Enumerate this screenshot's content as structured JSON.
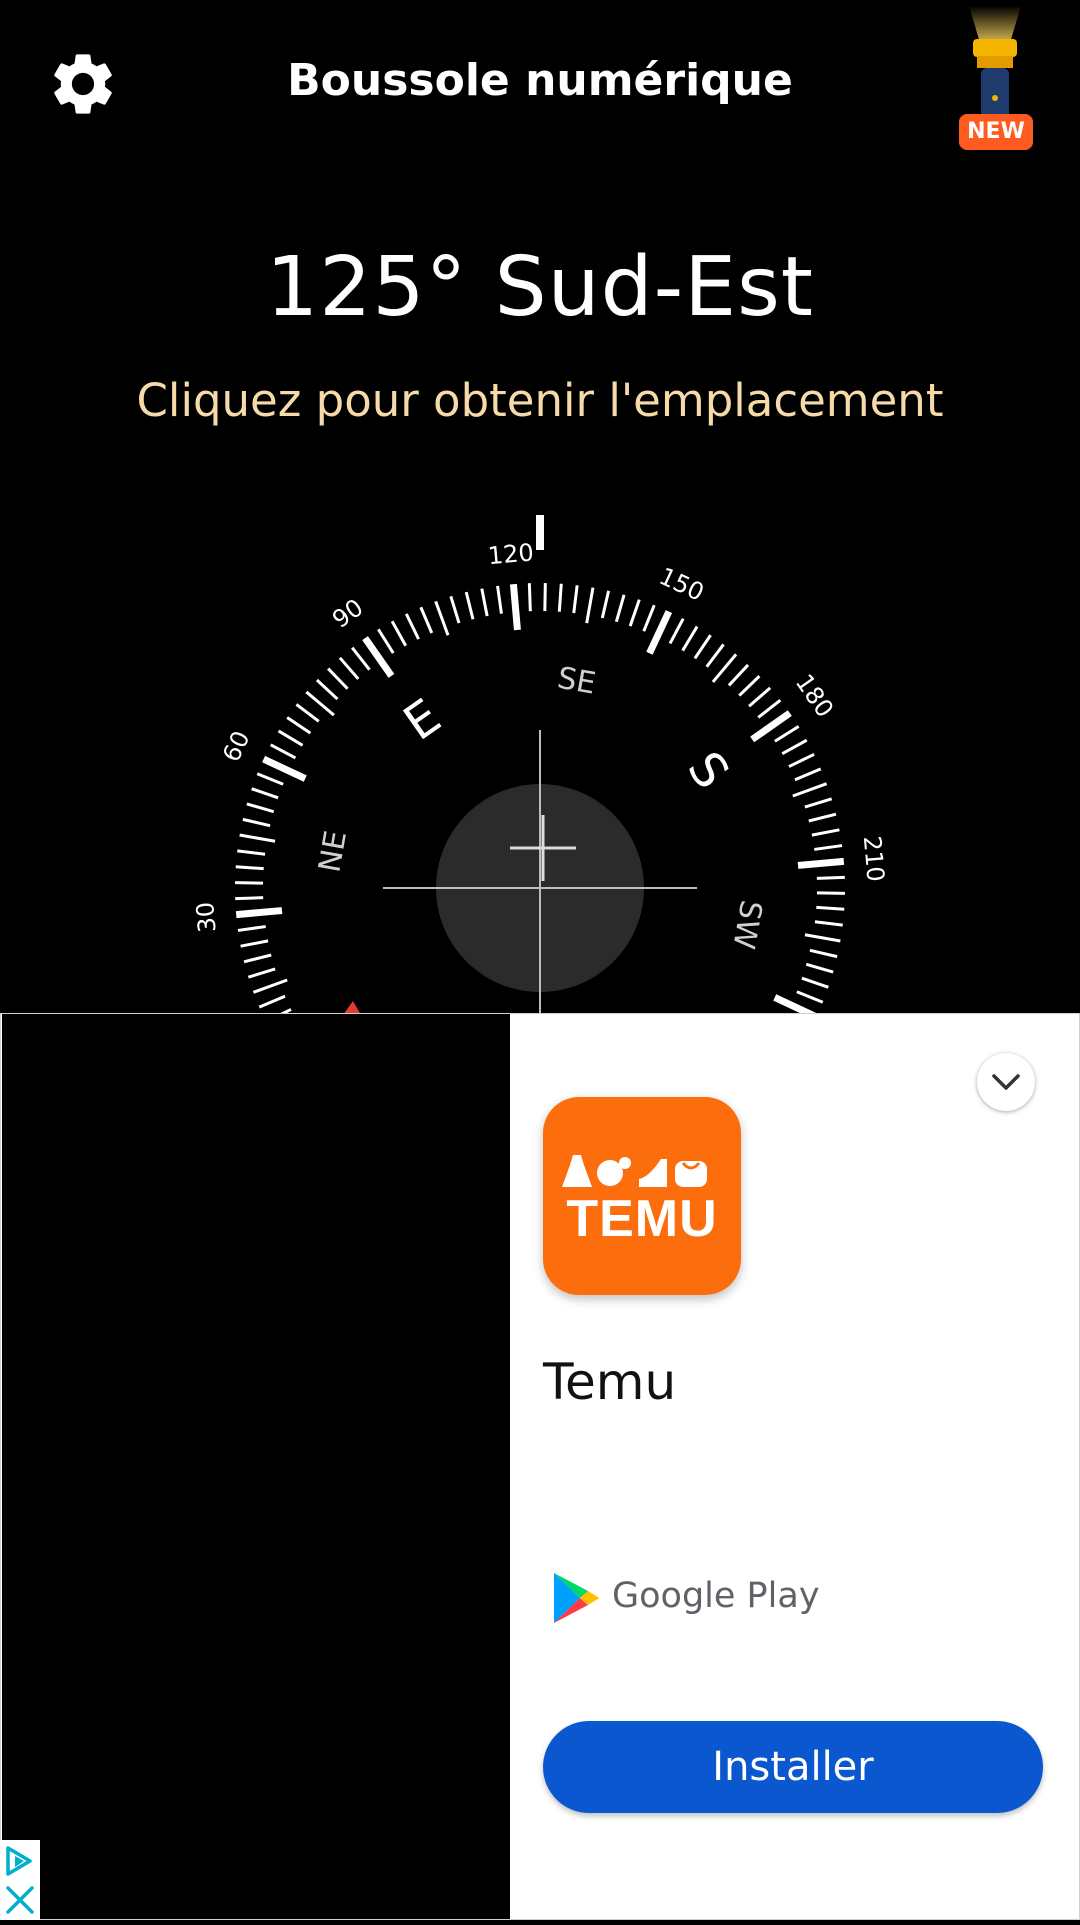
{
  "header": {
    "title": "Boussole numérique",
    "new_badge": "NEW",
    "icons": {
      "settings": "gear-icon",
      "flashlight": "flashlight-icon"
    }
  },
  "compass": {
    "heading_degrees": 125,
    "direction": "Sud-Est",
    "heading_text": "125° Sud-Est",
    "location_prompt": "Cliquez pour obtenir l'emplacement",
    "visible_degree_labels": [
      "30",
      "60",
      "90",
      "120",
      "150",
      "180",
      "210"
    ],
    "visible_cardinal_labels": [
      "NE",
      "E",
      "SE",
      "S",
      "SW"
    ],
    "colors": {
      "location_text": "#f6dba8",
      "north_marker": "#e53935"
    }
  },
  "ad": {
    "app_name": "Temu",
    "icon_text": "TEMU",
    "store_name": "Google Play",
    "install_label": "Installer",
    "icons": {
      "collapse": "chevron-down-icon",
      "adchoices": "adchoices-icon",
      "close": "close-icon"
    },
    "colors": {
      "brand": "#fb6d0d",
      "install_button": "#0b57d0"
    }
  }
}
